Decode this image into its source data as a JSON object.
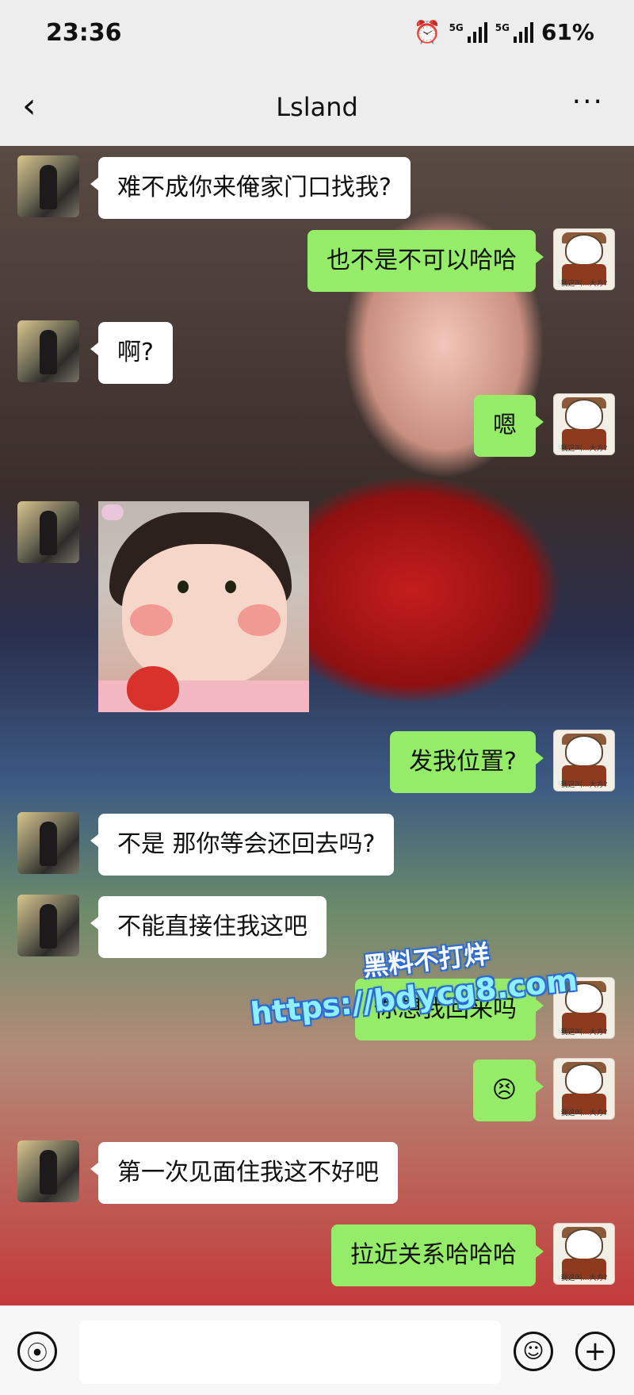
{
  "status_bar": {
    "time": "23:36",
    "network1": "5G",
    "network2": "5G",
    "battery": "61%"
  },
  "header": {
    "title": "Lsland",
    "back_icon": "chevron-left-icon",
    "more_icon": "more-dots-icon"
  },
  "messages": [
    {
      "side": "in",
      "type": "text",
      "text": "难不成你来俺家门口找我?"
    },
    {
      "side": "out",
      "type": "text",
      "text": "也不是不可以哈哈"
    },
    {
      "side": "in",
      "type": "text",
      "text": "啊?"
    },
    {
      "side": "out",
      "type": "text",
      "text": "嗯"
    },
    {
      "side": "in",
      "type": "image",
      "image_desc": "sticker-girl-strawberry"
    },
    {
      "side": "out",
      "type": "text",
      "text": "发我位置?"
    },
    {
      "side": "in",
      "type": "text",
      "text": "不是 那你等会还回去吗?"
    },
    {
      "side": "in",
      "type": "text",
      "text": "不能直接住我这吧"
    },
    {
      "side": "out",
      "type": "text",
      "text": "你想我回来吗"
    },
    {
      "side": "out",
      "type": "text",
      "text": "😣"
    },
    {
      "side": "in",
      "type": "text",
      "text": "第一次见面住我这不好吧"
    },
    {
      "side": "out",
      "type": "text",
      "text": "拉近关系哈哈哈"
    }
  ],
  "watermark": {
    "line1": "黑料不打烊",
    "line2": "https://bdycg8.com"
  },
  "avatar_right_caption": "我这叫…大方?",
  "input_bar": {
    "voice_icon": "voice-icon",
    "emoji_icon": "emoji-icon",
    "plus_icon": "plus-icon",
    "input_value": ""
  }
}
